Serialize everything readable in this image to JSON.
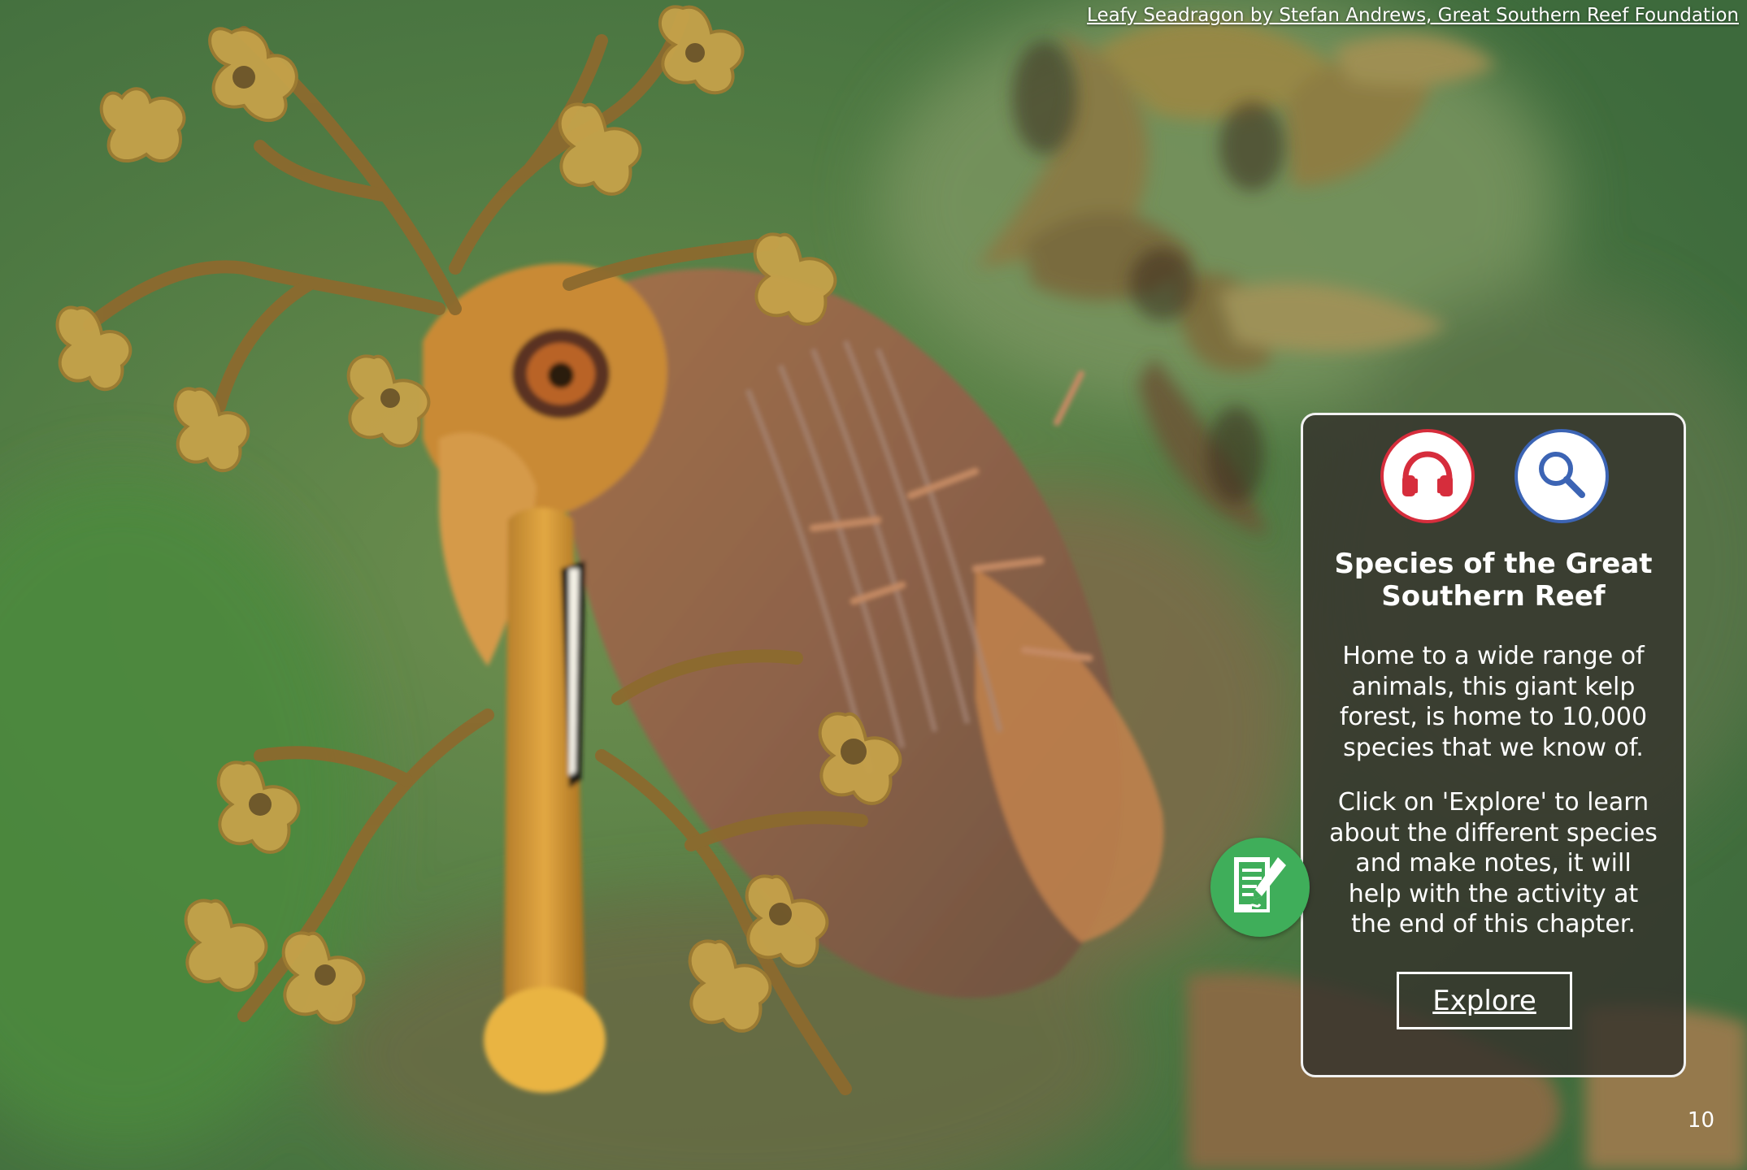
{
  "credit": {
    "text": "Leafy Seadragon by Stefan Andrews, Great Southern Reef Foundation"
  },
  "panel": {
    "title": "Species of the Great Southern Reef",
    "paragraph_1": "Home to a wide range of animals, this giant kelp forest, is home to 10,000 species that we know of.",
    "paragraph_2": "Click on 'Explore' to learn about the different species and make notes, it will help with the activity at the end of this chapter.",
    "explore_label": "Explore",
    "icons": [
      "headphones-icon",
      "magnifier-icon"
    ]
  },
  "notes_button": {
    "icon": "notes-pencil-icon"
  },
  "page_number": "10",
  "colors": {
    "headphones_accent": "#d62d3c",
    "magnifier_accent": "#3c64b4",
    "notes_button": "#3fae5a",
    "panel_background": "#34322c"
  }
}
